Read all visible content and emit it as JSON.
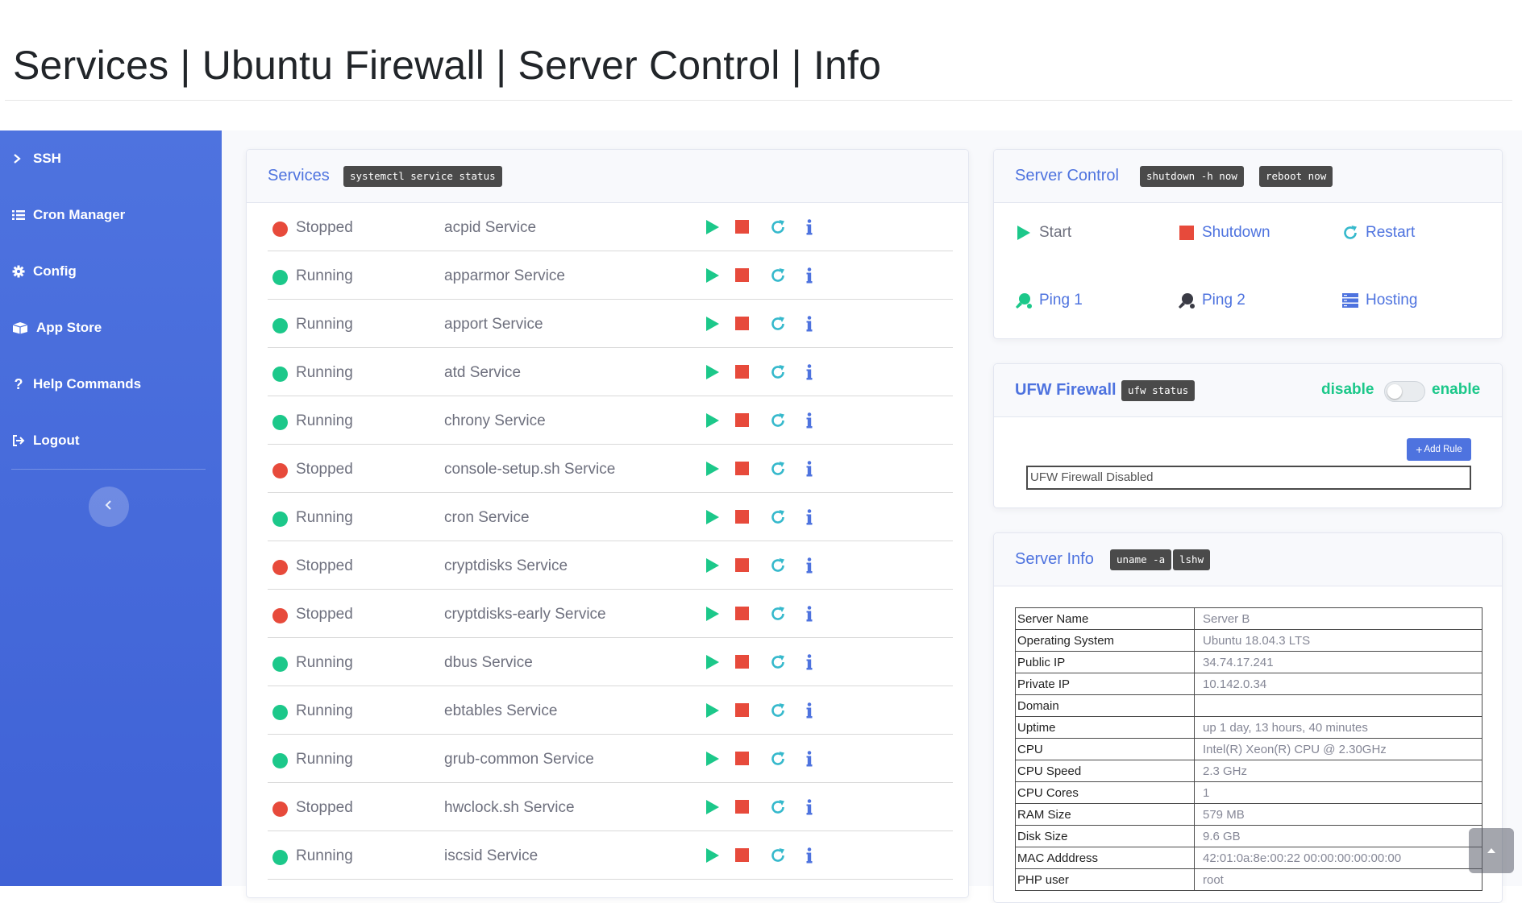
{
  "page": {
    "title": "Services | Ubuntu Firewall | Server Control | Info"
  },
  "colors": {
    "accent": "#4e73df",
    "success": "#1cc88a",
    "danger": "#e74a3b",
    "info": "#36b9cc",
    "text_muted": "#6e707e"
  },
  "sidebar": {
    "items": [
      {
        "label": "SSH",
        "icon": "terminal-icon"
      },
      {
        "label": "Cron Manager",
        "icon": "list-icon"
      },
      {
        "label": "Config",
        "icon": "gear-icon"
      },
      {
        "label": "App Store",
        "icon": "box-icon"
      },
      {
        "label": "Help Commands",
        "icon": "question-icon"
      },
      {
        "label": "Logout",
        "icon": "sign-out-icon"
      }
    ],
    "toggle_icon": "chevron-left-icon"
  },
  "services": {
    "title": "Services",
    "command": "systemctl service status",
    "rows": [
      {
        "status": "Stopped",
        "name": "acpid Service"
      },
      {
        "status": "Running",
        "name": "apparmor Service"
      },
      {
        "status": "Running",
        "name": "apport Service"
      },
      {
        "status": "Running",
        "name": "atd Service"
      },
      {
        "status": "Running",
        "name": "chrony Service"
      },
      {
        "status": "Stopped",
        "name": "console-setup.sh Service"
      },
      {
        "status": "Running",
        "name": "cron Service"
      },
      {
        "status": "Stopped",
        "name": "cryptdisks Service"
      },
      {
        "status": "Stopped",
        "name": "cryptdisks-early Service"
      },
      {
        "status": "Running",
        "name": "dbus Service"
      },
      {
        "status": "Running",
        "name": "ebtables Service"
      },
      {
        "status": "Running",
        "name": "grub-common Service"
      },
      {
        "status": "Stopped",
        "name": "hwclock.sh Service"
      },
      {
        "status": "Running",
        "name": "iscsid Service"
      }
    ]
  },
  "server_control": {
    "title": "Server Control",
    "commands": [
      "shutdown -h now",
      "reboot now"
    ],
    "buttons": [
      {
        "label": "Start",
        "icon": "play-icon"
      },
      {
        "label": "Shutdown",
        "icon": "stop-icon"
      },
      {
        "label": "Restart",
        "icon": "refresh-icon"
      },
      {
        "label": "Ping 1",
        "icon": "ping-pong-icon"
      },
      {
        "label": "Ping 2",
        "icon": "ping-pong-icon"
      },
      {
        "label": "Hosting",
        "icon": "server-icon"
      }
    ]
  },
  "ufw": {
    "title": "UFW Firewall",
    "command": "ufw status",
    "disable_label": "disable",
    "enable_label": "enable",
    "enabled": false,
    "add_rule_label": "Add Rule",
    "output": "UFW Firewall Disabled"
  },
  "server_info": {
    "title": "Server Info",
    "commands": [
      "uname -a",
      "lshw"
    ],
    "rows": [
      {
        "key": "Server Name",
        "value": "Server B"
      },
      {
        "key": "Operating System",
        "value": "Ubuntu 18.04.3 LTS"
      },
      {
        "key": "Public IP",
        "value": "34.74.17.241"
      },
      {
        "key": "Private IP",
        "value": "10.142.0.34"
      },
      {
        "key": "Domain",
        "value": ""
      },
      {
        "key": "Uptime",
        "value": "up 1 day, 13 hours, 40 minutes"
      },
      {
        "key": "CPU",
        "value": "Intel(R) Xeon(R) CPU @ 2.30GHz"
      },
      {
        "key": "CPU Speed",
        "value": "2.3 GHz"
      },
      {
        "key": "CPU Cores",
        "value": "1"
      },
      {
        "key": "RAM Size",
        "value": "579 MB"
      },
      {
        "key": "Disk Size",
        "value": "9.6 GB"
      },
      {
        "key": "MAC Adddress",
        "value": "42:01:0a:8e:00:22 00:00:00:00:00:00"
      },
      {
        "key": "PHP user",
        "value": "root"
      }
    ]
  }
}
